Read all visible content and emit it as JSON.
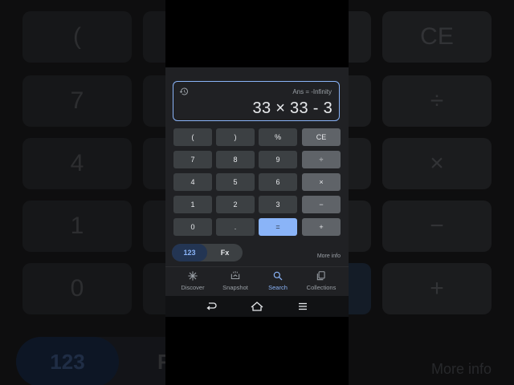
{
  "display": {
    "ans": "Ans = -Infinity",
    "expression": "33 × 33 - 3"
  },
  "keypad": {
    "rows": [
      [
        {
          "label": "(",
          "type": "num"
        },
        {
          "label": ")",
          "type": "num"
        },
        {
          "label": "%",
          "type": "num"
        },
        {
          "label": "CE",
          "type": "op"
        }
      ],
      [
        {
          "label": "7",
          "type": "num"
        },
        {
          "label": "8",
          "type": "num"
        },
        {
          "label": "9",
          "type": "num"
        },
        {
          "label": "÷",
          "type": "op"
        }
      ],
      [
        {
          "label": "4",
          "type": "num"
        },
        {
          "label": "5",
          "type": "num"
        },
        {
          "label": "6",
          "type": "num"
        },
        {
          "label": "×",
          "type": "op"
        }
      ],
      [
        {
          "label": "1",
          "type": "num"
        },
        {
          "label": "2",
          "type": "num"
        },
        {
          "label": "3",
          "type": "num"
        },
        {
          "label": "−",
          "type": "op"
        }
      ],
      [
        {
          "label": "0",
          "type": "num"
        },
        {
          "label": ".",
          "type": "num"
        },
        {
          "label": "=",
          "type": "eq"
        },
        {
          "label": "+",
          "type": "op"
        }
      ]
    ]
  },
  "mode": {
    "selected": "123",
    "options": [
      "123",
      "Fx"
    ]
  },
  "more_info": "More info",
  "nav": {
    "items": [
      {
        "label": "Discover",
        "icon": "discover-icon",
        "active": false
      },
      {
        "label": "Snapshot",
        "icon": "snapshot-icon",
        "active": false
      },
      {
        "label": "Search",
        "icon": "search-icon",
        "active": true
      },
      {
        "label": "Collections",
        "icon": "collections-icon",
        "active": false
      }
    ]
  },
  "system_bar": {
    "icons": [
      "back-icon",
      "home-icon",
      "recents-icon"
    ]
  },
  "colors": {
    "accent": "#8ab4f8",
    "background": "#202124",
    "key": "#3c4043",
    "operator_key": "#5f6368"
  },
  "backdrop": {
    "keys": [
      "(",
      "CE",
      "7",
      "÷",
      "4",
      "×",
      "1",
      "−",
      "0",
      "+"
    ],
    "mode_labels": [
      "123",
      "F"
    ],
    "more_info": "More info"
  }
}
